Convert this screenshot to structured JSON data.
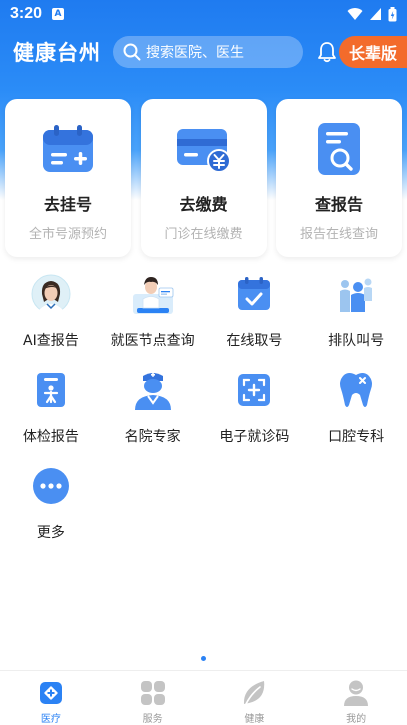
{
  "status_bar": {
    "time": "3:20",
    "notif": "A"
  },
  "header": {
    "title": "健康台州",
    "search_placeholder": "搜索医院、医生",
    "elder_mode": "长辈版"
  },
  "cards": [
    {
      "title": "去挂号",
      "subtitle": "全市号源预约",
      "icon": "calendar-add-icon"
    },
    {
      "title": "去缴费",
      "subtitle": "门诊在线缴费",
      "icon": "payment-card-icon"
    },
    {
      "title": "查报告",
      "subtitle": "报告在线查询",
      "icon": "report-search-icon"
    }
  ],
  "services": [
    {
      "label": "AI查报告",
      "icon": "ai-doctor-avatar-icon"
    },
    {
      "label": "就医节点查询",
      "icon": "doctor-node-query-icon"
    },
    {
      "label": "在线取号",
      "icon": "calendar-check-icon"
    },
    {
      "label": "排队叫号",
      "icon": "queue-people-icon"
    },
    {
      "label": "体检报告",
      "icon": "checkup-report-icon"
    },
    {
      "label": "名院专家",
      "icon": "expert-doctor-icon"
    },
    {
      "label": "电子就诊码",
      "icon": "scan-code-icon"
    },
    {
      "label": "口腔专科",
      "icon": "tooth-icon"
    },
    {
      "label": "更多",
      "icon": "more-dots-icon"
    }
  ],
  "tabbar": [
    {
      "label": "医疗",
      "active": true
    },
    {
      "label": "服务",
      "active": false
    },
    {
      "label": "健康",
      "active": false
    },
    {
      "label": "我的",
      "active": false
    }
  ],
  "colors": {
    "primary": "#2b82f4",
    "accent": "#f36b2b",
    "inactive": "#c4c4c4"
  }
}
